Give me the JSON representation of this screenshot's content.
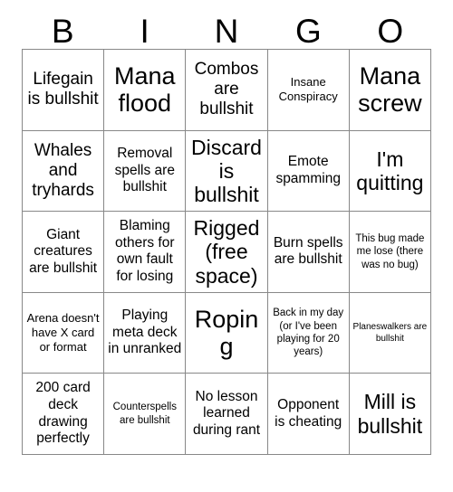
{
  "card": {
    "title": "BINGO",
    "header_letters": [
      "B",
      "I",
      "N",
      "G",
      "O"
    ],
    "free_space_index": 12,
    "colors": {
      "background": "#ffffff",
      "text": "#000000",
      "grid_line": "#888888"
    },
    "rows": [
      [
        {
          "text": "Lifegain is bullshit",
          "size": "lg"
        },
        {
          "text": "Mana flood",
          "size": "xxl"
        },
        {
          "text": "Combos are bullshit",
          "size": "lg"
        },
        {
          "text": "Insane Conspiracy",
          "size": "sm"
        },
        {
          "text": "Mana screw",
          "size": "xxl"
        }
      ],
      [
        {
          "text": "Whales and tryhards",
          "size": "lg"
        },
        {
          "text": "Removal spells are bullshit",
          "size": "md"
        },
        {
          "text": "Discard is bullshit",
          "size": "xl"
        },
        {
          "text": "Emote spamming",
          "size": "md"
        },
        {
          "text": "I'm quitting",
          "size": "xl"
        }
      ],
      [
        {
          "text": "Giant creatures are bullshit",
          "size": "md"
        },
        {
          "text": "Blaming others for own fault for losing",
          "size": "md"
        },
        {
          "text": "Rigged (free space)",
          "size": "xl"
        },
        {
          "text": "Burn spells are bullshit",
          "size": "md"
        },
        {
          "text": "This bug made me lose (there was no bug)",
          "size": "xs"
        }
      ],
      [
        {
          "text": "Arena doesn't have X card or format",
          "size": "sm"
        },
        {
          "text": "Playing meta deck in unranked",
          "size": "md"
        },
        {
          "text": "Roping",
          "size": "xxl"
        },
        {
          "text": "Back in my day (or I've been playing for 20 years)",
          "size": "xs"
        },
        {
          "text": "Planeswalkers are bullshit",
          "size": "xxs"
        }
      ],
      [
        {
          "text": "200 card deck drawing perfectly",
          "size": "md"
        },
        {
          "text": "Counterspells are bullshit",
          "size": "xs"
        },
        {
          "text": "No lesson learned during rant",
          "size": "md"
        },
        {
          "text": "Opponent is cheating",
          "size": "md"
        },
        {
          "text": "Mill is bullshit",
          "size": "xl"
        }
      ]
    ]
  }
}
